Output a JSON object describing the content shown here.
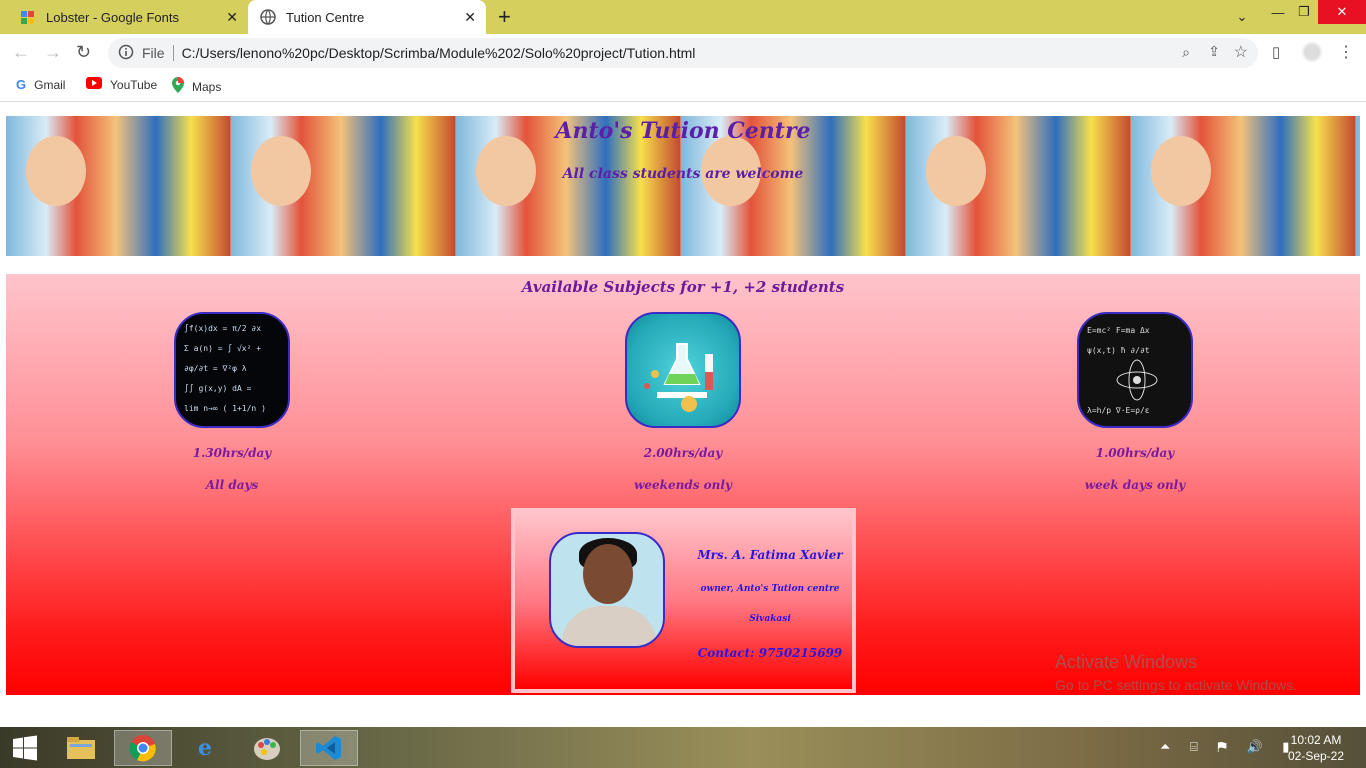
{
  "browser": {
    "tabs": [
      {
        "title": "Lobster - Google Fonts",
        "icon": "google-fonts-icon"
      },
      {
        "title": "Tution Centre",
        "icon": "globe-icon"
      }
    ],
    "url_prefix": "File",
    "url": "C:/Users/lenono%20pc/Desktop/Scrimba/Module%202/Solo%20project/Tution.html",
    "bookmarks": [
      {
        "label": "Gmail",
        "icon": "google-icon"
      },
      {
        "label": "YouTube",
        "icon": "youtube-icon"
      },
      {
        "label": "Maps",
        "icon": "maps-pin-icon"
      }
    ]
  },
  "page": {
    "title": "Anto's Tution Centre",
    "subtitle": "All class students are welcome",
    "heading": "Available Subjects for +1, +2 students",
    "subjects": [
      {
        "hours": "1.30hrs/day",
        "days": "All days",
        "image": "math-formulas"
      },
      {
        "hours": "2.00hrs/day",
        "days": "weekends only",
        "image": "chemistry-lab"
      },
      {
        "hours": "1.00hrs/day",
        "days": "week days only",
        "image": "physics-formulas"
      }
    ],
    "owner": {
      "name": "Mrs. A. Fatima Xavier",
      "role": "owner, Anto's Tution centre",
      "city": "Sivakasi",
      "contact": "Contact: 9750215699"
    }
  },
  "watermark": {
    "line1": "Activate Windows",
    "line2": "Go to PC settings to activate Windows."
  },
  "taskbar": {
    "time": "10:02 AM",
    "date": "02-Sep-22"
  }
}
